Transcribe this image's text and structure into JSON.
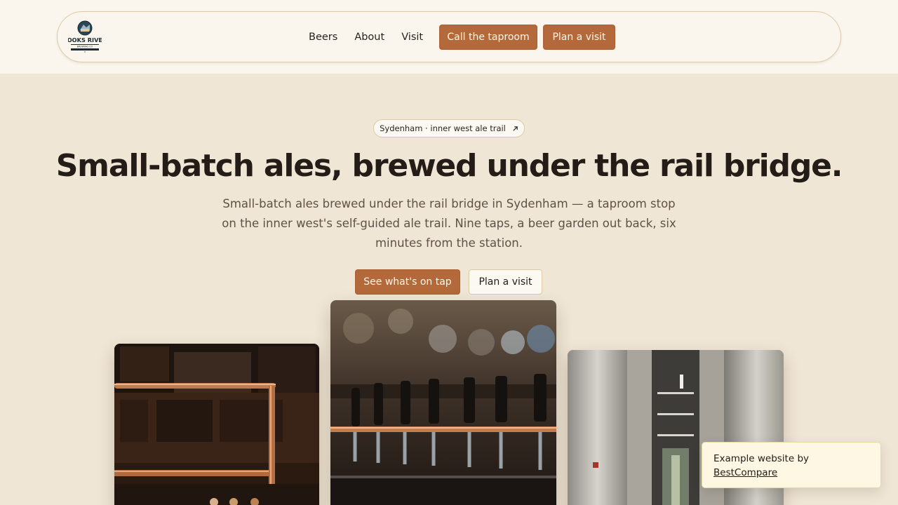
{
  "header": {
    "logo_alt": "Cooks River Brewing Co",
    "nav": [
      "Beers",
      "About",
      "Visit"
    ],
    "cta_call": "Call the taproom",
    "cta_visit": "Plan a visit"
  },
  "hero": {
    "eyebrow": "Sydenham · inner west ale trail",
    "eyebrow_icon": "arrow-up-right-icon",
    "headline": "Small-batch ales, brewed under the rail bridge.",
    "subhead": "Small-batch ales brewed under the rail bridge in Sydenham — a taproom stop on the inner west's self-guided ale trail. Nine taps, a beer garden out back, six minutes from the station.",
    "cta_primary": "See what's on tap",
    "cta_secondary": "Plan a visit"
  },
  "badge": {
    "text": "Example website by",
    "link": "BestCompare"
  },
  "colors": {
    "accent": "#b4693a",
    "background": "#f0e6d6",
    "header": "#faf6ee",
    "text": "#231c17",
    "muted_text": "#5e5248",
    "badge_bg": "#fdf7e3"
  }
}
